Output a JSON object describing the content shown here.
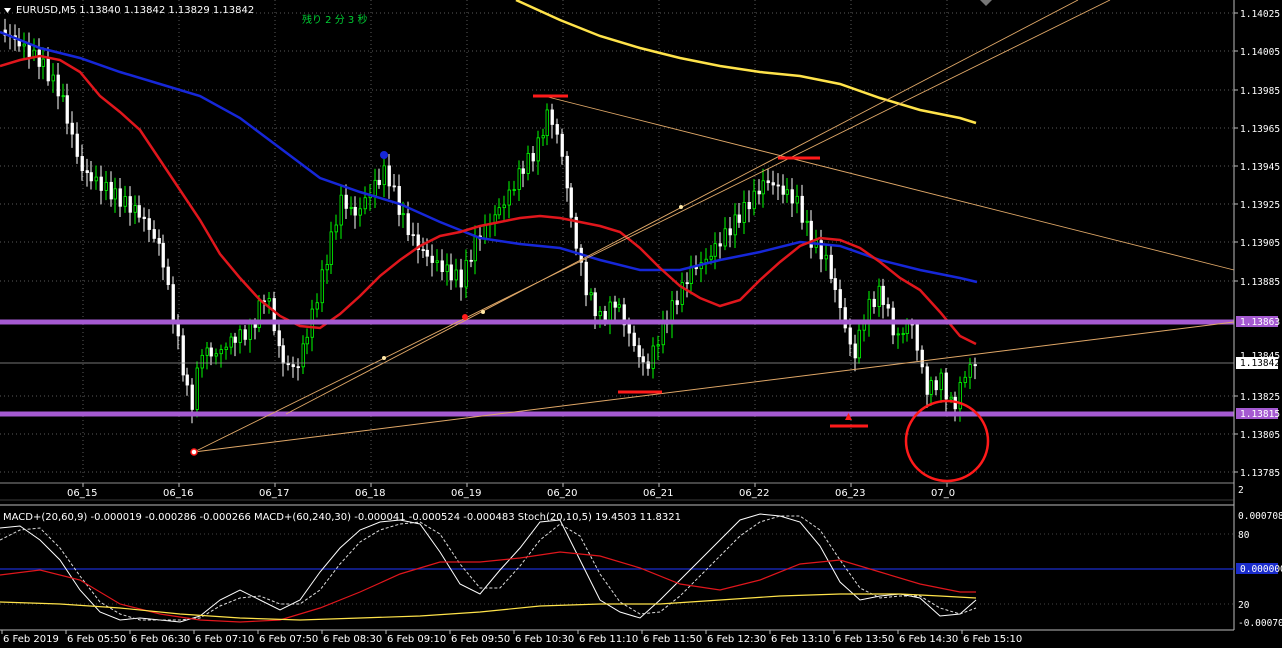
{
  "header": {
    "symbol_info": "EURUSD,M5  1.13840 1.13842 1.13829 1.13842",
    "countdown": "残り 2 分 3 秒"
  },
  "price_axis": {
    "labels": [
      "1.14025",
      "1.14005",
      "1.13985",
      "1.13965",
      "1.13945",
      "1.13925",
      "1.13905",
      "1.13885",
      "1.13825",
      "1.13805",
      "1.13785"
    ],
    "current_price_badge": "1.13842",
    "level_high_badge": "1.13863",
    "level_low_badge": "1.13815",
    "partial_label": "1.13845"
  },
  "upper_dates": [
    "06_15",
    "06_16",
    "06_17",
    "06_18",
    "06_19",
    "06_20",
    "06_21",
    "06_22",
    "06_23",
    "07_0"
  ],
  "indicator_panel": {
    "label": "MACD+(20,60,9) -0.000019 -0.000286 -0.000266  MACD+(60,240,30) -0.000041 -0.000524 -0.000483  Stoch(20,10,5) 19.4503 11.8321",
    "axis_top": "0.000708",
    "axis_80": "80",
    "axis_zero_badge": "0.000000",
    "axis_20": "20",
    "axis_bottom": "-0.000708",
    "separator_label": "2"
  },
  "time_axis": [
    "6 Feb 2019",
    "6 Feb 05:50",
    "6 Feb 06:30",
    "6 Feb 07:10",
    "6 Feb 07:50",
    "6 Feb 08:30",
    "6 Feb 09:10",
    "6 Feb 09:50",
    "6 Feb 10:30",
    "6 Feb 11:10",
    "6 Feb 11:50",
    "6 Feb 12:30",
    "6 Feb 13:10",
    "6 Feb 13:50",
    "6 Feb 14:30",
    "6 Feb 15:10"
  ],
  "colors": {
    "bull": "#00ff00",
    "bear": "#ffffff",
    "ma_red": "#e0161c",
    "ma_blue": "#1627d8",
    "ma_yellow": "#ffe34a",
    "level_purple": "#a55ad1",
    "trendline": "#e0a868",
    "zero_line": "#1a2ccc",
    "grid": "#5a5a5a",
    "marker_red": "#ff1a1a"
  }
}
